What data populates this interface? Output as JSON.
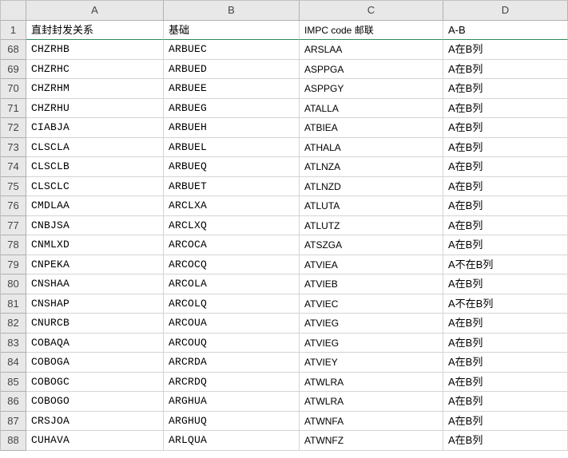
{
  "columns": [
    "A",
    "B",
    "C",
    "D"
  ],
  "headers": {
    "A": "直封封发关系",
    "B": "基础",
    "C": "IMPC code 邮联",
    "D": "A-B"
  },
  "header_row_number": "1",
  "rows": [
    {
      "n": "68",
      "A": "CHZRHB",
      "B": "ARBUEC",
      "C": "ARSLAA",
      "D": "A在B列"
    },
    {
      "n": "69",
      "A": "CHZRHC",
      "B": "ARBUED",
      "C": "ASPPGA",
      "D": "A在B列"
    },
    {
      "n": "70",
      "A": "CHZRHM",
      "B": "ARBUEE",
      "C": "ASPPGY",
      "D": "A在B列"
    },
    {
      "n": "71",
      "A": "CHZRHU",
      "B": "ARBUEG",
      "C": "ATALLA",
      "D": "A在B列"
    },
    {
      "n": "72",
      "A": "CIABJA",
      "B": "ARBUEH",
      "C": "ATBIEA",
      "D": "A在B列"
    },
    {
      "n": "73",
      "A": "CLSCLA",
      "B": "ARBUEL",
      "C": "ATHALA",
      "D": "A在B列"
    },
    {
      "n": "74",
      "A": "CLSCLB",
      "B": "ARBUEQ",
      "C": "ATLNZA",
      "D": "A在B列"
    },
    {
      "n": "75",
      "A": "CLSCLC",
      "B": "ARBUET",
      "C": "ATLNZD",
      "D": "A在B列"
    },
    {
      "n": "76",
      "A": "CMDLAA",
      "B": "ARCLXA",
      "C": "ATLUTA",
      "D": "A在B列"
    },
    {
      "n": "77",
      "A": "CNBJSA",
      "B": "ARCLXQ",
      "C": "ATLUTZ",
      "D": "A在B列"
    },
    {
      "n": "78",
      "A": "CNMLXD",
      "B": "ARCOCA",
      "C": "ATSZGA",
      "D": "A在B列"
    },
    {
      "n": "79",
      "A": "CNPEKA",
      "B": "ARCOCQ",
      "C": "ATVIEA",
      "D": "A不在B列"
    },
    {
      "n": "80",
      "A": "CNSHAA",
      "B": "ARCOLA",
      "C": "ATVIEB",
      "D": "A在B列"
    },
    {
      "n": "81",
      "A": "CNSHAP",
      "B": "ARCOLQ",
      "C": "ATVIEC",
      "D": "A不在B列"
    },
    {
      "n": "82",
      "A": "CNURCB",
      "B": "ARCOUA",
      "C": "ATVIEG",
      "D": "A在B列"
    },
    {
      "n": "83",
      "A": "COBAQA",
      "B": "ARCOUQ",
      "C": "ATVIEG",
      "D": "A在B列"
    },
    {
      "n": "84",
      "A": "COBOGA",
      "B": "ARCRDA",
      "C": "ATVIEY",
      "D": "A在B列"
    },
    {
      "n": "85",
      "A": "COBOGC",
      "B": "ARCRDQ",
      "C": "ATWLRA",
      "D": "A在B列"
    },
    {
      "n": "86",
      "A": "COBOGO",
      "B": "ARGHUA",
      "C": "ATWLRA",
      "D": "A在B列"
    },
    {
      "n": "87",
      "A": "CRSJOA",
      "B": "ARGHUQ",
      "C": "ATWNFA",
      "D": "A在B列"
    },
    {
      "n": "88",
      "A": "CUHAVA",
      "B": "ARLQUA",
      "C": "ATWNFZ",
      "D": "A在B列"
    }
  ]
}
